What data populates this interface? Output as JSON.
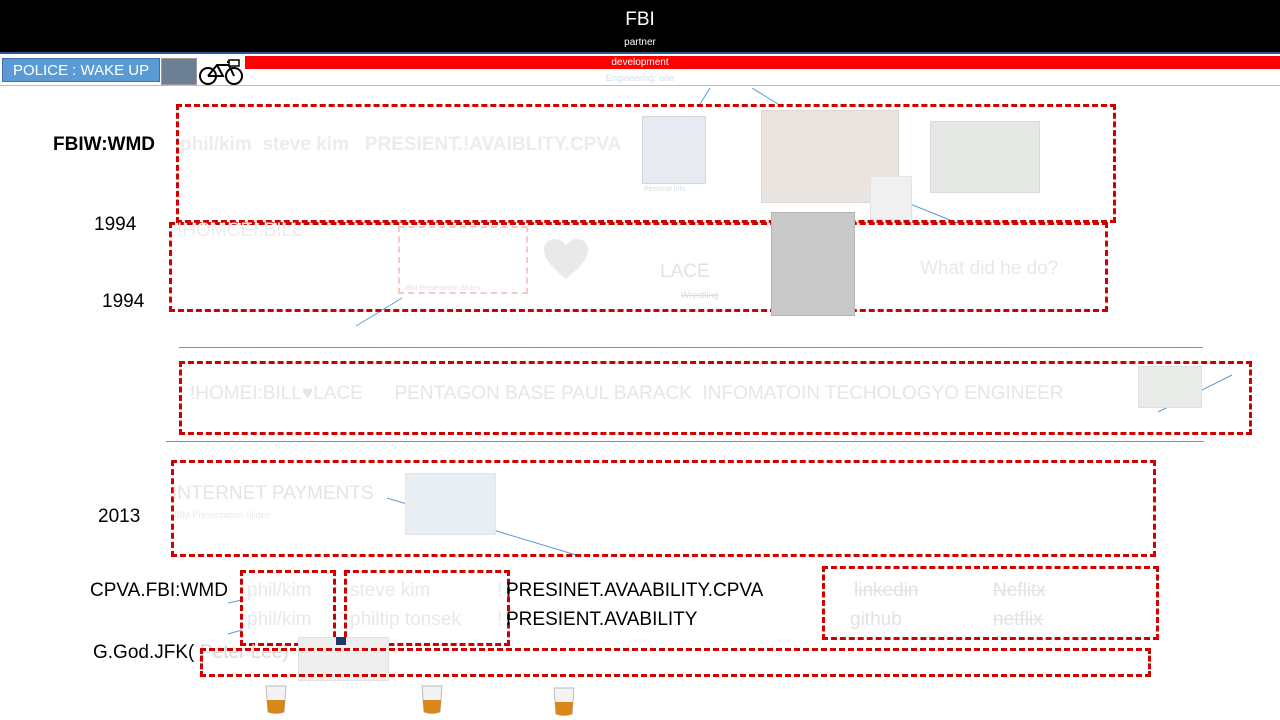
{
  "header": {
    "title": "FBI",
    "subtitle": "partner"
  },
  "nav": {
    "button_label": "POLICE : WAKE UP",
    "red_bar_label": "development",
    "faint_bar_label": "Engineering: one"
  },
  "row1": {
    "label": "FBIW:WMD",
    "faint_text": "phil/kim  steve kim   PRESIENT.!AVAIBLITY.CPVA",
    "card_caption": "Personal Info"
  },
  "row2": {
    "year_top": "1994",
    "year_bottom": "1994",
    "faint_label": "!HOMCEI:BILL",
    "lace_label": "LACE",
    "lace_sub": "Wrestling",
    "question": "What did he do?",
    "image_caption": "IBM Presentation Slides",
    "heart_icon": "heart-icon"
  },
  "row3": {
    "faint_text": "!HOMEI:BILL♥LACE      PENTAGON BASE PAUL BARACK  INFOMATOIN TECHOLOGYO ENGINEER"
  },
  "row4": {
    "year": "2013",
    "title": "INTERNET PAYMENTS",
    "subtitle": "IBM Presentation Slides"
  },
  "row5": {
    "label": "CPVA.FBI:WMD",
    "faint_col1_line1": "phil/kim",
    "faint_col1_line2": "phil/kim",
    "faint_col2_line1": "steve kim",
    "faint_col2_line2": "philtip tonsek",
    "faint_excl1": "!",
    "faint_excl2": "!",
    "line1": "PRESINET.AVAABILITY.CPVA",
    "line2": "PRESIENT.AVABILITY",
    "links": [
      "linkedin",
      "github",
      "Neflitx",
      "netflix"
    ]
  },
  "row6": {
    "label_dark": "G.God.JFK(",
    "label_faint": "Peter Lee)"
  },
  "colors": {
    "accent": "#5b9bd5",
    "danger": "#d00000",
    "header_bg": "#000000"
  }
}
